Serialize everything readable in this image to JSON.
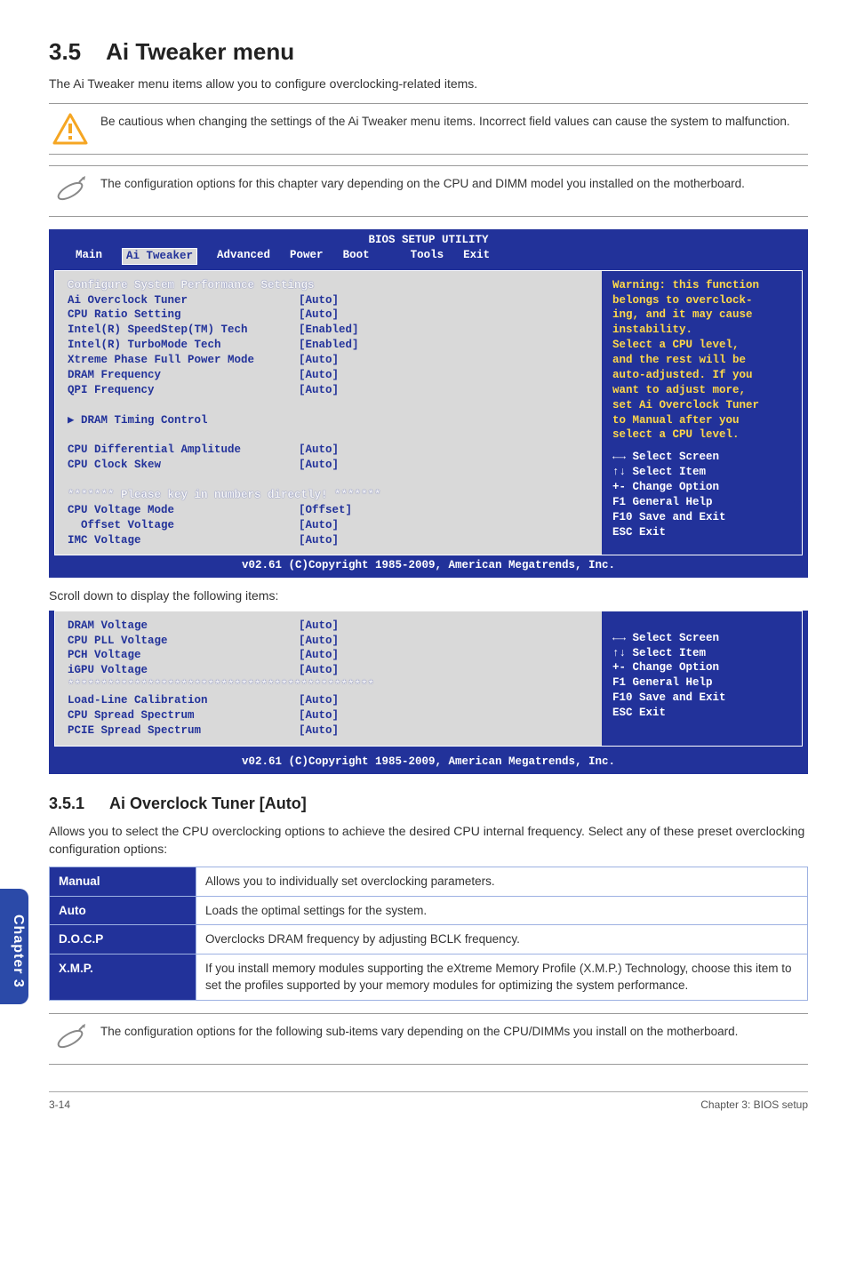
{
  "heading": {
    "num": "3.5",
    "title": "Ai Tweaker menu"
  },
  "intro": "The Ai Tweaker menu items allow you to configure overclocking-related items.",
  "callouts": {
    "warn": "Be cautious when changing the settings of the Ai Tweaker menu items. Incorrect field values can cause the system to malfunction.",
    "note1": "The configuration options for this chapter vary depending on the CPU and DIMM model you installed on the motherboard.",
    "note2": "The configuration options for the following sub-items vary depending on the CPU/DIMMs you install on the motherboard."
  },
  "bios": {
    "title": "BIOS SETUP UTILITY",
    "tabs": [
      "Main",
      "Ai Tweaker",
      "Advanced",
      "Power",
      "Boot",
      "Tools",
      "Exit"
    ],
    "panel1_heading": "Configure System Performance Settings",
    "panel1_items": [
      {
        "label": "Ai Overclock Tuner",
        "value": "[Auto]"
      },
      {
        "label": "CPU Ratio Setting",
        "value": "[Auto]"
      },
      {
        "label": "Intel(R) SpeedStep(TM) Tech",
        "value": "[Enabled]"
      },
      {
        "label": "Intel(R) TurboMode Tech",
        "value": "[Enabled]"
      },
      {
        "label": "Xtreme Phase Full Power Mode",
        "value": "[Auto]"
      },
      {
        "label": "DRAM Frequency",
        "value": "[Auto]"
      },
      {
        "label": "QPI Frequency",
        "value": "[Auto]"
      }
    ],
    "panel1_sub": "DRAM Timing Control",
    "panel1_items2": [
      {
        "label": "CPU Differential Amplitude",
        "value": "[Auto]"
      },
      {
        "label": "CPU Clock Skew",
        "value": "[Auto]"
      }
    ],
    "panel1_pleasekey": "******* Please key in numbers directly! *******",
    "panel1_items3": [
      {
        "label": "CPU Voltage Mode",
        "value": "[Offset]"
      },
      {
        "label": "  Offset Voltage",
        "value": "[Auto]"
      },
      {
        "label": "IMC Voltage",
        "value": "[Auto]"
      }
    ],
    "help_warning_title": "Warning: this function",
    "help_warning_body": "belongs to overclock-\ning, and it may cause\ninstability.\nSelect a CPU level,\nand the rest will be\nauto-adjusted. If you\nwant to adjust more,\nset Ai Overclock Tuner\nto Manual after you\nselect a CPU level.",
    "help_keys": "←→   Select Screen\n↑↓   Select Item\n+-   Change Option\nF1   General Help\nF10  Save and Exit\nESC  Exit",
    "footer": "v02.61 (C)Copyright 1985-2009, American Megatrends, Inc.",
    "scroll_note": "Scroll down to display the following items:",
    "panel2_items": [
      {
        "label": "DRAM Voltage",
        "value": "[Auto]"
      },
      {
        "label": "CPU PLL Voltage",
        "value": "[Auto]"
      },
      {
        "label": "PCH Voltage",
        "value": "[Auto]"
      },
      {
        "label": "iGPU Voltage",
        "value": "[Auto]"
      }
    ],
    "panel2_stars": "**********************************************",
    "panel2_items2": [
      {
        "label": "Load-Line Calibration",
        "value": "[Auto]"
      },
      {
        "label": "CPU Spread Spectrum",
        "value": "[Auto]"
      },
      {
        "label": "PCIE Spread Spectrum",
        "value": "[Auto]"
      }
    ]
  },
  "sub": {
    "num": "3.5.1",
    "title": "Ai Overclock Tuner [Auto]",
    "desc": "Allows you to select the CPU overclocking options to achieve the desired CPU internal frequency. Select any of these preset overclocking configuration options:"
  },
  "options": [
    {
      "k": "Manual",
      "v": "Allows you to individually set overclocking parameters."
    },
    {
      "k": "Auto",
      "v": "Loads the optimal settings for the system."
    },
    {
      "k": "D.O.C.P",
      "v": "Overclocks DRAM frequency by adjusting BCLK frequency."
    },
    {
      "k": "X.M.P.",
      "v": "If you install memory modules supporting the eXtreme Memory Profile (X.M.P.) Technology, choose this item to set the profiles supported by your memory modules for optimizing the system performance."
    }
  ],
  "chapter_tab": "Chapter 3",
  "footer": {
    "left": "3-14",
    "right": "Chapter 3: BIOS setup"
  }
}
